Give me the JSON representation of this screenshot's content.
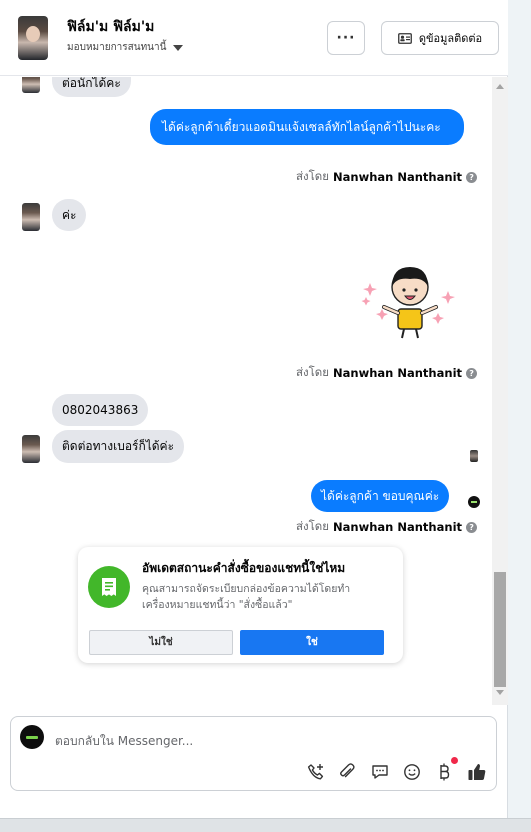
{
  "header": {
    "contact_name": "ฟิล์ม'ม ฟิล์ม'ม",
    "assign_label": "มอบหมายการสนทนานี้",
    "more_label": "···",
    "contact_info_label": "ดูข้อมูลติดต่อ"
  },
  "messages": {
    "partial_top": "ต่อนักได้คะ",
    "out1": "ได้ค่ะลูกค้าเดี๋ยวแอดมินแจ้งเซลล์ทักไลน์ลูกค้าไปนะคะ",
    "in_kha": "ค่ะ",
    "phone": "0802043863",
    "in_call": "ติดต่อทางเบอร์ก็ได้ค่ะ",
    "out2": "ได้ค่ะลูกค้า ขอบคุณค่ะ",
    "sent_by_prefix": "ส่งโดย",
    "sent_by_name": "Nanwhan Nanthanit",
    "help_glyph": "?"
  },
  "order_card": {
    "title": "อัพเดตสถานะคำสั่งซื้อของแชทนี้ใช่ไหม",
    "description": "คุณสามารถจัดระเบียบกล่องข้อความได้โดยทำเครื่องหมายแชทนี้ว่า \"สั่งซื้อแล้ว\"",
    "no_label": "ไม่ใช่",
    "yes_label": "ใช่"
  },
  "composer": {
    "placeholder": "ตอบกลับใน Messenger..."
  },
  "colors": {
    "brand_blue": "#0a7cff",
    "button_blue": "#1877f2",
    "green": "#42b72a",
    "notification": "#f0284a"
  }
}
